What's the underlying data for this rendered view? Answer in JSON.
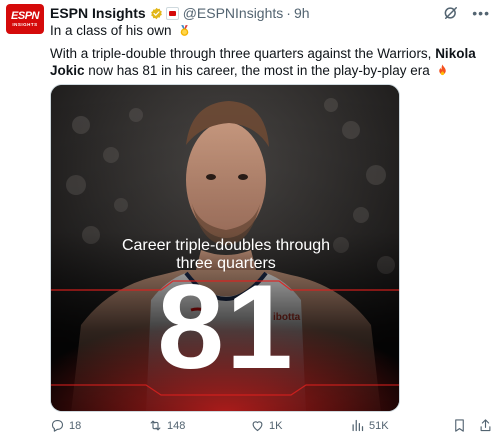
{
  "tweet": {
    "display_name": "ESPN Insights",
    "handle": "@ESPNInsights",
    "separator": "·",
    "time": "9h",
    "avatar": {
      "logo_top": "ESPN",
      "logo_bottom": "INSIGHTS",
      "color": "#d50a0a"
    },
    "line1": "In a class of his own",
    "line2_before": "With a triple-double through three quarters against the Warriors, ",
    "line2_bold": "Nikola Jokic",
    "line2_after": " now has 81 in his career, the most in the play-by-play era",
    "icons": {
      "verified": "verified-gold-badge-icon",
      "affiliate": "affiliate-badge-icon",
      "grok": "grok-icon",
      "more": "more-icon",
      "medal": "medal-emoji-icon",
      "fire": "fire-emoji-icon"
    }
  },
  "media": {
    "caption_line1": "Career triple-doubles through",
    "caption_line2": "three quarters",
    "big_number": "81",
    "jersey_sponsor": "ibotta",
    "accent_color": "#e0201e"
  },
  "actions": {
    "replies": "18",
    "retweets": "148",
    "likes": "1K",
    "views": "51K"
  }
}
